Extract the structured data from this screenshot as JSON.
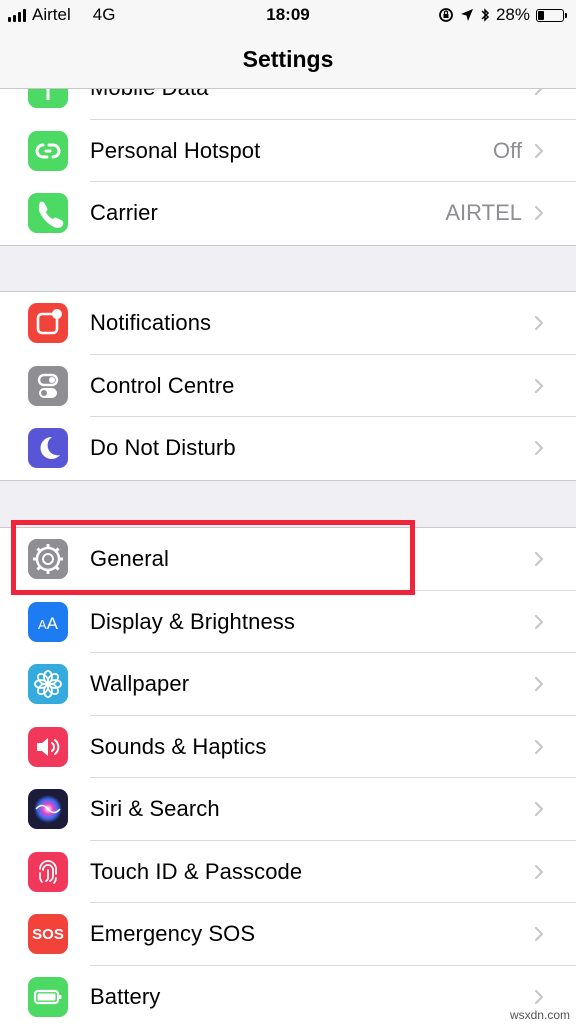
{
  "status_bar": {
    "carrier": "Airtel",
    "network": "4G",
    "time": "18:09",
    "battery_percent": "28%",
    "battery_level": 0.28
  },
  "nav": {
    "title": "Settings"
  },
  "groups": [
    {
      "items": [
        {
          "label": "Mobile Data",
          "icon": "mobile-data-icon",
          "color": "#4cd964",
          "value": ""
        },
        {
          "label": "Personal Hotspot",
          "icon": "hotspot-icon",
          "color": "#4cd964",
          "value": "Off"
        },
        {
          "label": "Carrier",
          "icon": "phone-icon",
          "color": "#4cd964",
          "value": "AIRTEL"
        }
      ]
    },
    {
      "items": [
        {
          "label": "Notifications",
          "icon": "notifications-icon",
          "color": "#f2433a"
        },
        {
          "label": "Control Centre",
          "icon": "control-centre-icon",
          "color": "#8e8e93"
        },
        {
          "label": "Do Not Disturb",
          "icon": "moon-icon",
          "color": "#5856d6"
        }
      ]
    },
    {
      "items": [
        {
          "label": "General",
          "icon": "gear-icon",
          "color": "#8e8e93"
        },
        {
          "label": "Display & Brightness",
          "icon": "display-icon",
          "color": "#1d7cf2"
        },
        {
          "label": "Wallpaper",
          "icon": "wallpaper-icon",
          "color": "#35aadc"
        },
        {
          "label": "Sounds & Haptics",
          "icon": "speaker-icon",
          "color": "#f2385a"
        },
        {
          "label": "Siri & Search",
          "icon": "siri-icon",
          "color": "#1c1c3a"
        },
        {
          "label": "Touch ID & Passcode",
          "icon": "fingerprint-icon",
          "color": "#f2385a"
        },
        {
          "label": "Emergency SOS",
          "icon": "sos-icon",
          "color": "#f2433a",
          "icon_text": "SOS"
        },
        {
          "label": "Battery",
          "icon": "battery-icon",
          "color": "#4cd964"
        }
      ]
    }
  ],
  "watermark": "wsxdn.com"
}
